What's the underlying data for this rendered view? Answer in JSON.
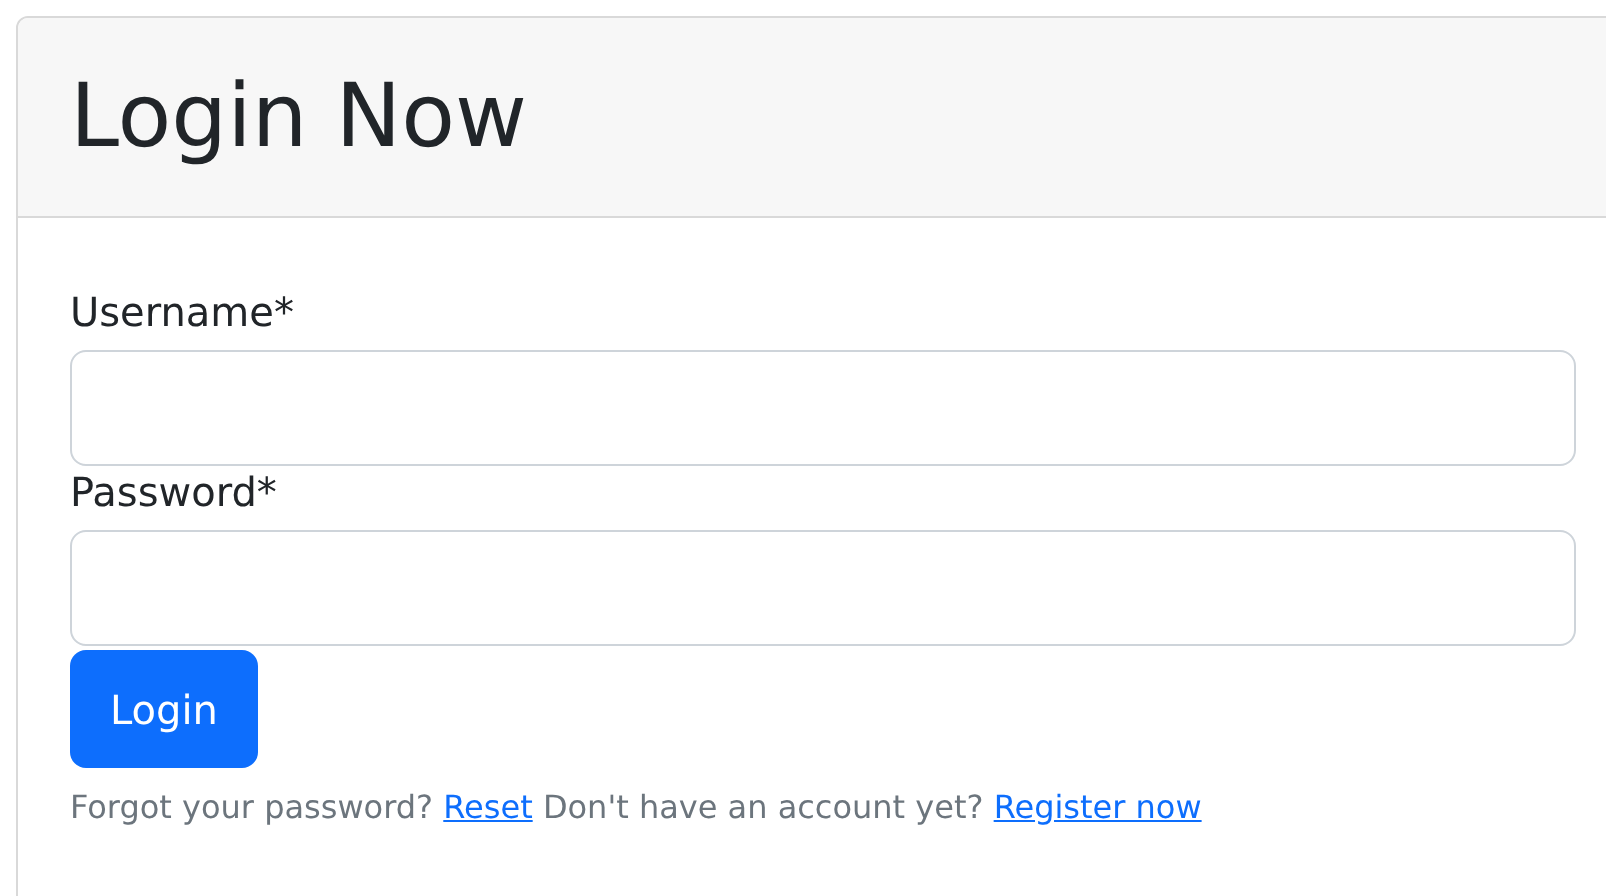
{
  "card": {
    "title": "Login Now"
  },
  "fields": [
    {
      "label": "Username*"
    },
    {
      "label": "Password*"
    }
  ],
  "submit": {
    "label": "Login"
  },
  "footer": [
    {
      "kind": "text",
      "text": "Forgot your password?"
    },
    {
      "kind": "link",
      "text": "Reset"
    },
    {
      "kind": "text",
      "text": "Don't have an account yet?"
    },
    {
      "kind": "link",
      "text": "Register now"
    }
  ]
}
